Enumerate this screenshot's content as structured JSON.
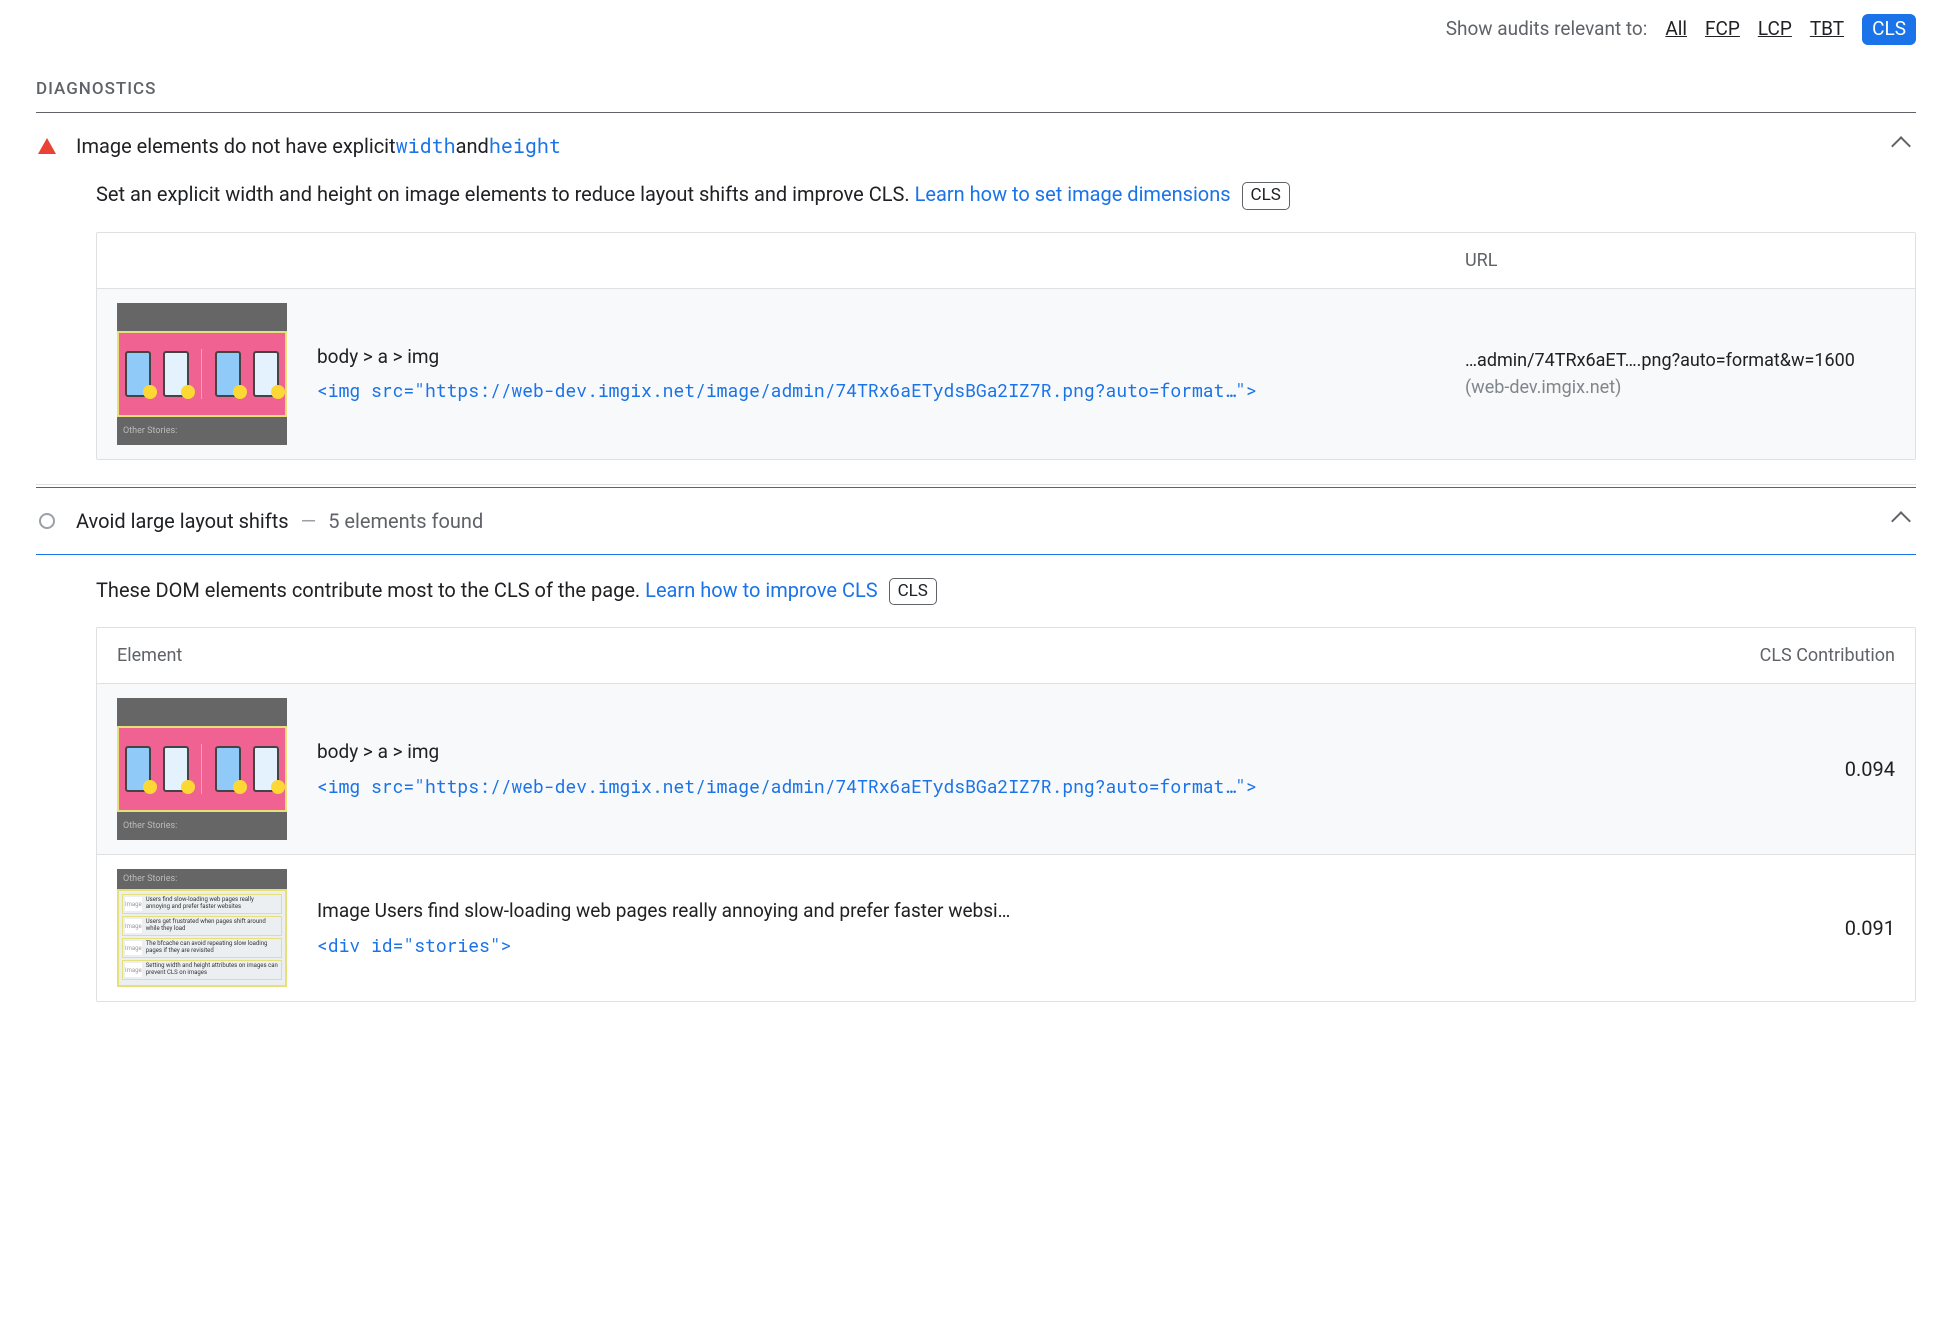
{
  "filter": {
    "label": "Show audits relevant to:",
    "options": [
      "All",
      "FCP",
      "LCP",
      "TBT"
    ],
    "active": "CLS"
  },
  "section_title": "DIAGNOSTICS",
  "audit1": {
    "title_pre": "Image elements do not have explicit ",
    "code_w": "width",
    "mid": " and ",
    "code_h": "height",
    "desc_a": "Set an explicit width and height on image elements to reduce layout shifts and improve CLS. ",
    "link": "Learn how to set image dimensions",
    "tag": "CLS",
    "table": {
      "th_url": "URL",
      "row": {
        "path": "body > a > img",
        "snippet_a": "<img src=\"https://web-dev.imgix.net/image/admin/74TRx6aETydsBGa2IZ7R.png?auto=format…\">",
        "url_short": "…admin/74TRx6aET….png?auto=format&w=1600",
        "url_host": "(web-dev.imgix.net)"
      }
    },
    "thumb_caption": "Other Stories:"
  },
  "audit2": {
    "title": "Avoid large layout shifts",
    "sub": "5 elements found",
    "desc_a": "These DOM elements contribute most to the CLS of the page. ",
    "link": "Learn how to improve CLS",
    "tag": "CLS",
    "table": {
      "th_el": "Element",
      "th_cls": "CLS Contribution",
      "rows": [
        {
          "path": "body > a > img",
          "snippet": "<img src=\"https://web-dev.imgix.net/image/admin/74TRx6aETydsBGa2IZ7R.png?auto=format…\">",
          "cls": "0.094",
          "thumb_caption": "Other Stories:"
        },
        {
          "desc": "Image Users find slow-loading web pages really annoying and prefer faster websi…",
          "snippet": "<div id=\"stories\">",
          "cls": "0.091",
          "thumb_caption": "Other Stories:",
          "s1": "Users find slow-loading web pages really annoying and prefer faster websites",
          "s2": "Users get frustrated when pages shift around while they load",
          "s3": "The bfcache can avoid repeating slow loading pages if they are revisited",
          "s4": "Setting width and height attributes on images can prevent CLS on images"
        }
      ]
    }
  }
}
